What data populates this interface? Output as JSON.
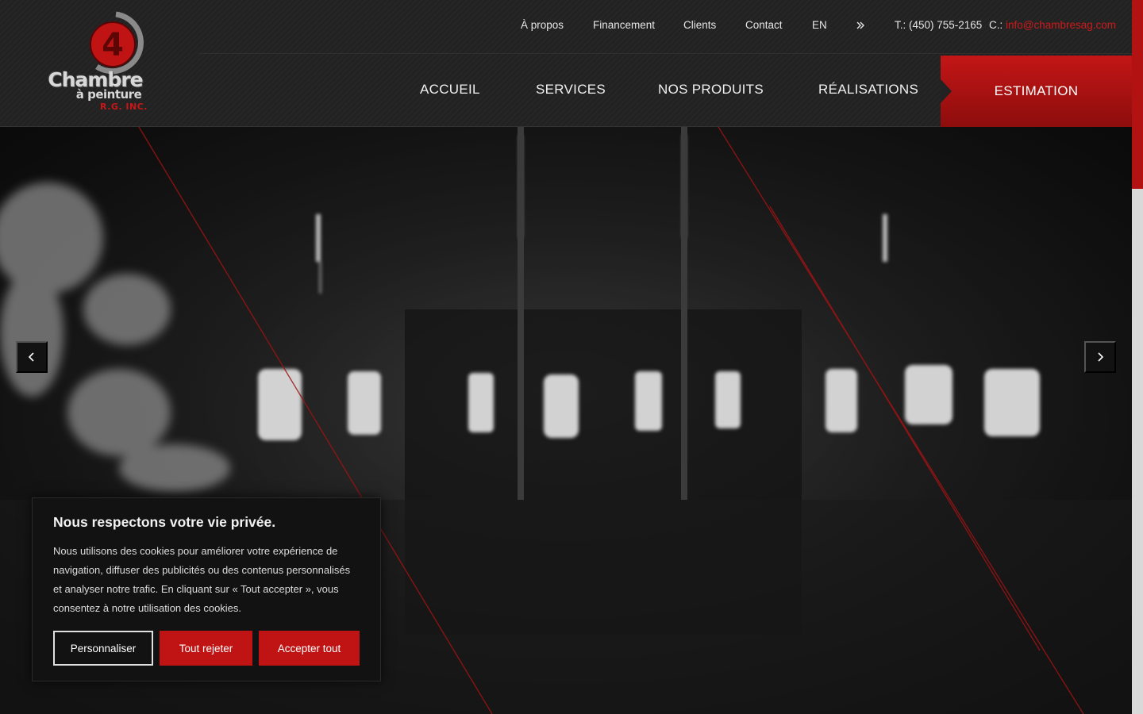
{
  "brand": {
    "logo_line1": "Chambre",
    "logo_line2": "à peinture",
    "logo_line3": "R.G. INC.",
    "emblem_glyph": "4",
    "icon": "logo-emblem-icon",
    "accent_color": "#c01414"
  },
  "topbar": {
    "items": [
      "À propos",
      "Financement",
      "Clients",
      "Contact",
      "EN"
    ],
    "more_icon": "double-chevron-right-icon",
    "phone_label": "T.: (450) 755-2165",
    "email_prefix": "C.:",
    "email": "info@chambresag.com"
  },
  "mainnav": {
    "items": [
      "ACCUEIL",
      "SERVICES",
      "NOS PRODUITS",
      "RÉALISATIONS"
    ],
    "cta": "ESTIMATION"
  },
  "slider": {
    "prev_icon": "chevron-left-icon",
    "next_icon": "chevron-right-icon"
  },
  "cookie": {
    "title": "Nous respectons votre vie privée.",
    "text": "Nous utilisons des cookies pour améliorer votre expérience de navigation, diffuser des publicités ou des contenus personnalisés et analyser notre trafic. En cliquant sur « Tout accepter », vous consentez à notre utilisation des cookies.",
    "customize": "Personnaliser",
    "reject": "Tout rejeter",
    "accept": "Accepter tout"
  }
}
